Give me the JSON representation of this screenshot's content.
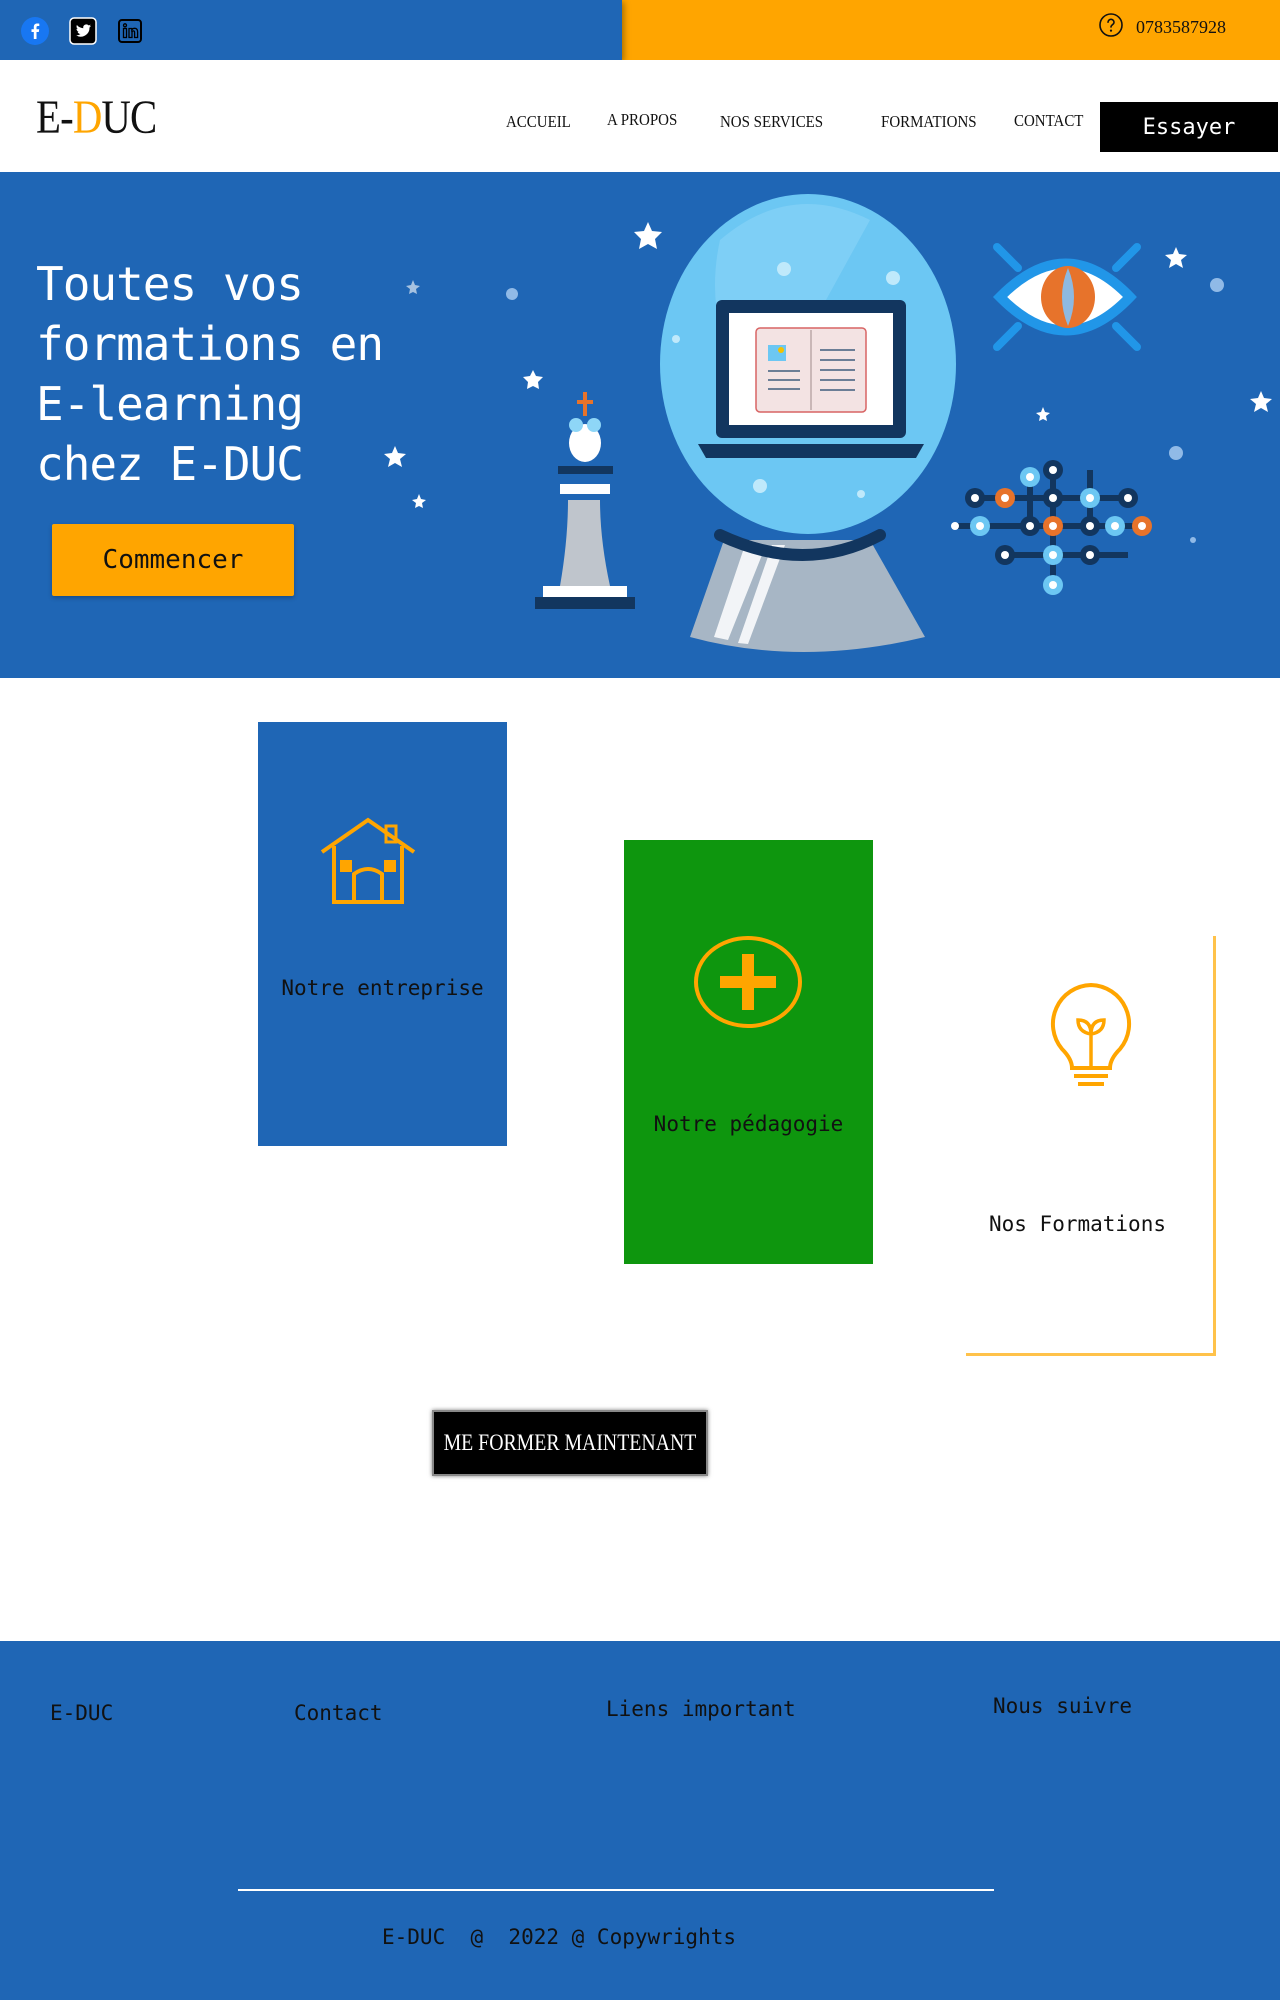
{
  "topbar": {
    "social": [
      "facebook-icon",
      "twitter-icon",
      "linkedin-icon"
    ],
    "phone": "0783587928",
    "phone_icon": "help-circle-icon"
  },
  "header": {
    "logo_prefix": "E-",
    "logo_accent": "D",
    "logo_suffix": "UC",
    "nav": [
      "ACCUEIL",
      "A PROPOS",
      "NOS SERVICES",
      "FORMATIONS",
      "CONTACT"
    ],
    "cta": "Essayer"
  },
  "hero": {
    "title_lines": [
      "Toutes vos",
      "formations en",
      "E-learning",
      "chez E-DUC"
    ],
    "button": "Commencer"
  },
  "cards": [
    {
      "label": "Notre entreprise",
      "icon": "house-icon"
    },
    {
      "label": "Notre pédagogie",
      "icon": "plus-circle-icon"
    },
    {
      "label": "Nos Formations",
      "icon": "lightbulb-icon"
    }
  ],
  "main_cta": "ME FORMER MAINTENANT",
  "footer": {
    "columns": [
      "E-DUC",
      "Contact",
      "Liens important",
      "Nous suivre"
    ],
    "copyright": "E-DUC  @  2022 @ Copywrights"
  },
  "colors": {
    "primary_blue": "#1F66B5",
    "accent_orange": "#FFA500",
    "green": "#0E960E"
  }
}
